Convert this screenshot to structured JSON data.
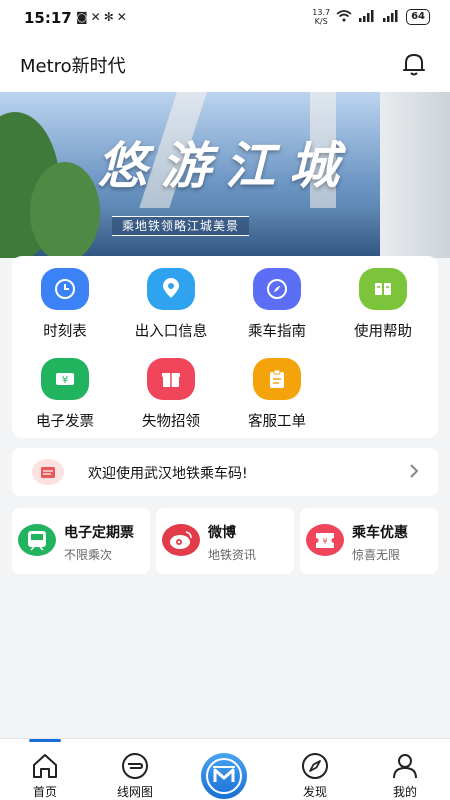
{
  "status_bar": {
    "time": "15:17",
    "net_speed_value": "13.7",
    "net_speed_unit": "K/S",
    "battery": "64"
  },
  "app_bar": {
    "title": "Metro新时代"
  },
  "banner": {
    "headline": "悠游江城",
    "subtitle": "乘地铁领略江城美景"
  },
  "quick_menu": [
    {
      "label": "时刻表",
      "icon": "clock-icon",
      "color": "#3b82f6"
    },
    {
      "label": "出入口信息",
      "icon": "location-pin-icon",
      "color": "#2fa3f0"
    },
    {
      "label": "乘车指南",
      "icon": "compass-icon",
      "color": "#5b6ef5"
    },
    {
      "label": "使用帮助",
      "icon": "book-icon",
      "color": "#7cc43a"
    },
    {
      "label": "电子发票",
      "icon": "invoice-ticket-icon",
      "color": "#22b35e"
    },
    {
      "label": "失物招领",
      "icon": "gift-box-icon",
      "color": "#f0455a"
    },
    {
      "label": "客服工单",
      "icon": "clipboard-icon",
      "color": "#f5a30a"
    }
  ],
  "notice": {
    "text": "欢迎使用武汉地铁乘车码!",
    "icon": "ticket-card-icon"
  },
  "feature_cards": [
    {
      "title": "电子定期票",
      "subtitle": "不限乘次",
      "icon": "train-icon",
      "color": "#22b35e"
    },
    {
      "title": "微博",
      "subtitle": "地铁资讯",
      "icon": "weibo-icon",
      "color": "#e23b4a"
    },
    {
      "title": "乘车优惠",
      "subtitle": "惊喜无限",
      "icon": "coupon-icon",
      "color": "#f0455a"
    }
  ],
  "tab_bar": {
    "items": [
      {
        "label": "首页",
        "icon": "home-icon"
      },
      {
        "label": "线网图",
        "icon": "network-map-icon"
      },
      {
        "label": "",
        "icon": "metro-logo-icon"
      },
      {
        "label": "发现",
        "icon": "discover-compass-icon"
      },
      {
        "label": "我的",
        "icon": "profile-icon"
      }
    ],
    "active_color": "#1a6fd6"
  }
}
